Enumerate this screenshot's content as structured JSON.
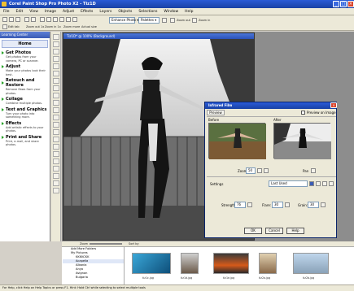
{
  "window": {
    "title": "Corel Paint Shop Pro Photo X2 - Tiz1D"
  },
  "menu": [
    "File",
    "Edit",
    "View",
    "Image",
    "Adjust",
    "Effects",
    "Layers",
    "Objects",
    "Selections",
    "Window",
    "Help"
  ],
  "toolbar": {
    "buttons": [
      "Edit tab",
      "Zoom out 1x",
      "Zoom in 1x",
      "Zoom more",
      "Actual size"
    ],
    "enhance_label": "Enhance Photo",
    "palettes_label": "Palettes",
    "zoom_out_label": "Zoom out",
    "zoom_in_label": "Zoom in"
  },
  "learning_center": {
    "header": "Learning Center",
    "home": "Home",
    "sections": [
      {
        "title": "Get Photos",
        "desc": "Get photos from your camera, PC or scanner."
      },
      {
        "title": "Adjust",
        "desc": "Make your photos look their best."
      },
      {
        "title": "Retouch and Restore",
        "desc": "Remove flaws from your photos."
      },
      {
        "title": "Collage",
        "desc": "Combine multiple photos."
      },
      {
        "title": "Text and Graphics",
        "desc": "Turn your photo into something more."
      },
      {
        "title": "Effects",
        "desc": "Add artistic effects to your photos."
      },
      {
        "title": "Print and Share",
        "desc": "Print, e-mail, and share photos."
      }
    ]
  },
  "image_window": {
    "title": "Tiz1D* @ 100% (Background)"
  },
  "dialog": {
    "title": "Infrared Film",
    "preview_tab": "Preview",
    "preview_on_image": "Preview on Image",
    "before": "Before",
    "after": "After",
    "zoom_label": "Zoom",
    "zoom_value": "50",
    "pan_label": "Pan",
    "settings_label": "Settings",
    "settings_value": "Last Used",
    "strength_label": "Strength:",
    "strength_value": "76",
    "flare_label": "Flare:",
    "flare_value": "30",
    "grain_label": "Grain:",
    "grain_value": "30",
    "ok": "OK",
    "cancel": "Cancel",
    "help": "Help"
  },
  "organizer": {
    "zoom_label": "Zoom",
    "sort_label": "Sort by",
    "tree": [
      "Add More Folders",
      "My Pictures",
      "KKKKCKK",
      "Acapella",
      "Albania",
      "Anyo",
      "Avignon",
      "Bulgaria"
    ],
    "thumbs": [
      "tiz1c.jpg",
      "tiz1d.jpg",
      "tiz1e.jpg",
      "tiz2a.jpg",
      "tiz2b.jpg"
    ]
  },
  "statusbar": {
    "text": "For Help, click Help on Help Topics or press F1. Hint: Hold Ctrl while selecting to select multiple tools"
  }
}
